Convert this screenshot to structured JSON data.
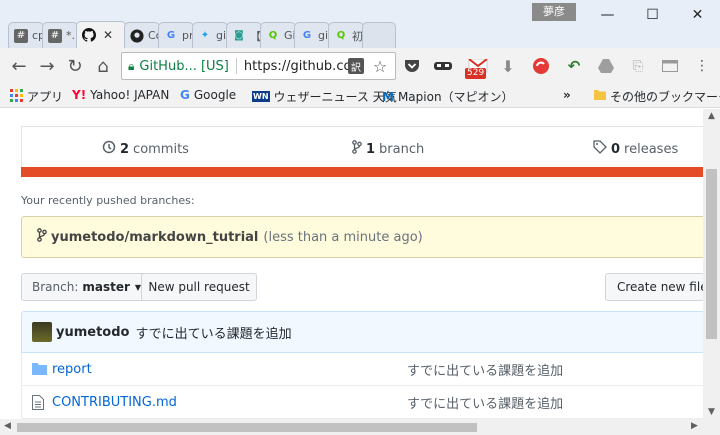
{
  "window": {
    "user_badge": "夢彦",
    "minimize": "—",
    "maximize": "☐",
    "close": "✕"
  },
  "tabs": [
    {
      "icon": "#",
      "label": "cp",
      "icon_bg": "#666",
      "icon_fg": "#fff"
    },
    {
      "icon": "#",
      "label": "*.p",
      "icon_bg": "#666",
      "icon_fg": "#fff"
    },
    {
      "icon": "●",
      "label": "",
      "icon_bg": "transparent",
      "icon_fg": "#111",
      "active": true,
      "close": "✕"
    },
    {
      "icon": "●",
      "label": "Co",
      "icon_bg": "transparent",
      "icon_fg": "#111"
    },
    {
      "icon": "G",
      "label": "pra",
      "icon_bg": "transparent",
      "icon_fg": "#4285f4"
    },
    {
      "icon": "✦",
      "label": "git",
      "icon_bg": "transparent",
      "icon_fg": "#1da1f2"
    },
    {
      "icon": "◙",
      "label": "【超",
      "icon_bg": "transparent",
      "icon_fg": "#2a9d8f"
    },
    {
      "icon": "Q",
      "label": "Gi",
      "icon_bg": "transparent",
      "icon_fg": "#55c500"
    },
    {
      "icon": "G",
      "label": "git",
      "icon_bg": "transparent",
      "icon_fg": "#4285f4"
    },
    {
      "icon": "Q",
      "label": "初",
      "icon_bg": "transparent",
      "icon_fg": "#55c500"
    }
  ],
  "nav": {
    "back": "←",
    "forward": "→",
    "reload": "↻",
    "home": "⌂"
  },
  "omnibox": {
    "secure_label": "GitHub... [US]",
    "url": "https://github.com",
    "translate": "訳",
    "star": "☆"
  },
  "extensions": {
    "gmail_count": "529"
  },
  "bookmarks": {
    "apps": "アプリ",
    "items": [
      "Yahoo! JAPAN",
      "Google",
      "ウェザーニュース 天気",
      "Mapion（マピオン）"
    ],
    "more": "»",
    "other": "その他のブックマーク"
  },
  "repo": {
    "commits_count": "2",
    "commits_label": "commits",
    "branch_count": "1",
    "branch_label": "branch",
    "releases_count": "0",
    "releases_label": "releases",
    "lang_color": "#e34c26",
    "recent_label": "Your recently pushed branches:",
    "recent_branch": "yumetodo/markdown_tutrial",
    "recent_time": "(less than a minute ago)",
    "branch_select_prefix": "Branch:",
    "branch_select_value": "master",
    "new_pr": "New pull request",
    "create_file": "Create new file",
    "latest_author": "yumetodo",
    "latest_message": "すでに出ている課題を追加",
    "files": [
      {
        "type": "folder",
        "name": "report",
        "message": "すでに出ている課題を追加"
      },
      {
        "type": "file",
        "name": "CONTRIBUTING.md",
        "message": "すでに出ている課題を追加"
      }
    ]
  }
}
